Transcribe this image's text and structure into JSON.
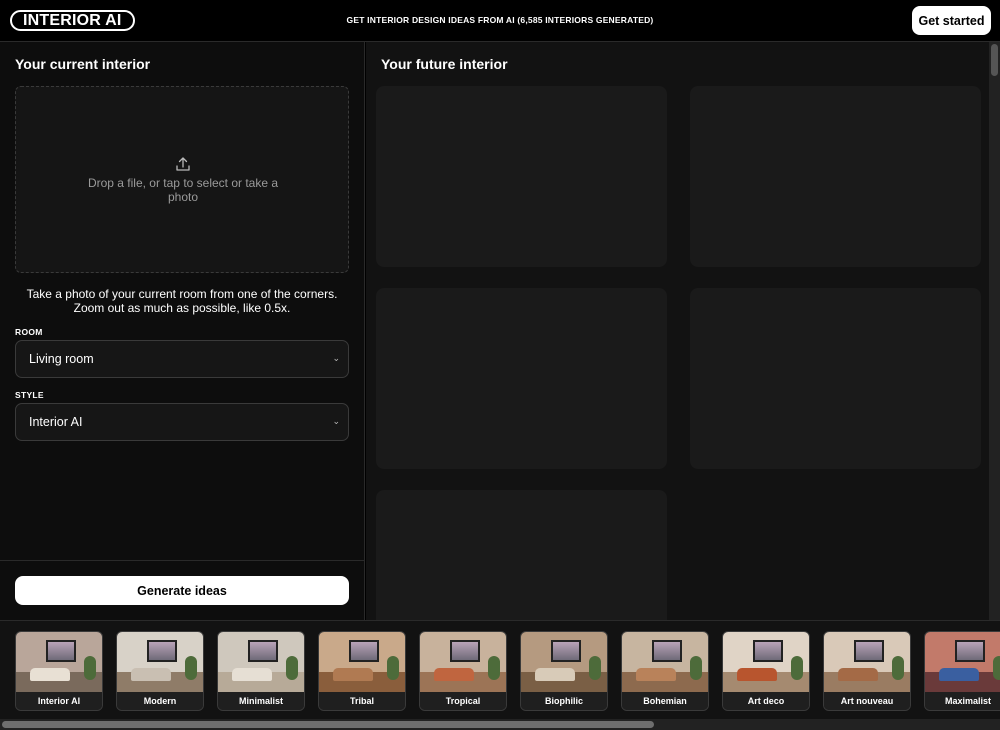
{
  "header": {
    "logo": "INTERIOR AI",
    "tagline": "GET INTERIOR DESIGN IDEAS FROM AI (6,585 INTERIORS GENERATED)",
    "cta_label": "Get started"
  },
  "left": {
    "title": "Your current interior",
    "dropzone": {
      "icon": "upload-icon",
      "text": "Drop a file, or tap to select or take a photo"
    },
    "hint": "Take a photo of your current room from one of the corners. Zoom out as much as possible, like 0.5x.",
    "room": {
      "label": "ROOM",
      "value": "Living room"
    },
    "style": {
      "label": "STYLE",
      "value": "Interior AI"
    },
    "generate_label": "Generate ideas"
  },
  "right": {
    "title": "Your future interior",
    "placeholder_count": 5
  },
  "styles": [
    {
      "label": "Interior AI",
      "wall": "#b9a69a",
      "floor": "#7a6a5c",
      "sofa": "#e8e0d4"
    },
    {
      "label": "Modern",
      "wall": "#d8d2c8",
      "floor": "#8f7c68",
      "sofa": "#c9bfb2"
    },
    {
      "label": "Minimalist",
      "wall": "#cfc8bd",
      "floor": "#b7aa98",
      "sofa": "#e6dfd4"
    },
    {
      "label": "Tribal",
      "wall": "#c9a98a",
      "floor": "#8a5e3c",
      "sofa": "#b07a52"
    },
    {
      "label": "Tropical",
      "wall": "#c8b29c",
      "floor": "#9c7456",
      "sofa": "#c0653f"
    },
    {
      "label": "Biophilic",
      "wall": "#b59a80",
      "floor": "#7a5f45",
      "sofa": "#d8cbb8"
    },
    {
      "label": "Bohemian",
      "wall": "#c7b5a0",
      "floor": "#8d6a4e",
      "sofa": "#b9825a"
    },
    {
      "label": "Art deco",
      "wall": "#e0d4c6",
      "floor": "#a58a70",
      "sofa": "#b8552e"
    },
    {
      "label": "Art nouveau",
      "wall": "#d9c9b8",
      "floor": "#9a7c62",
      "sofa": "#a46a46"
    },
    {
      "label": "Maximalist",
      "wall": "#c27a6a",
      "floor": "#6a3a3a",
      "sofa": "#3a5fa0"
    }
  ],
  "colors": {
    "background": "#000000",
    "panel": "#0d0d0d",
    "result_placeholder": "#1a1a1a",
    "button": "#ffffff"
  }
}
